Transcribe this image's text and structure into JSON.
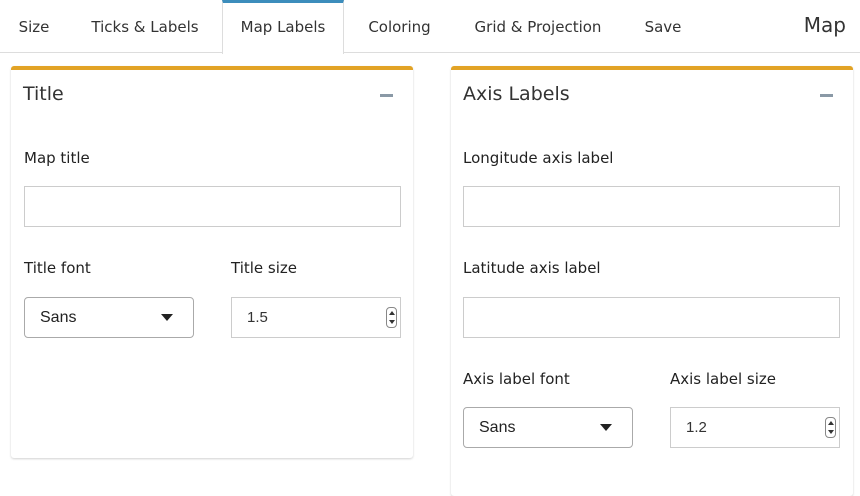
{
  "tabs": [
    {
      "label": "Size",
      "active": false
    },
    {
      "label": "Ticks & Labels",
      "active": false
    },
    {
      "label": "Map Labels",
      "active": true
    },
    {
      "label": "Coloring",
      "active": false
    },
    {
      "label": "Grid & Projection",
      "active": false
    },
    {
      "label": "Save",
      "active": false
    }
  ],
  "header": {
    "title": "Map"
  },
  "colors": {
    "accent_tab": "#3c8dbc",
    "box_border": "#e2a325"
  },
  "title_box": {
    "title": "Title",
    "collapse_icon": "minus-icon",
    "map_title_label": "Map title",
    "map_title_value": "",
    "title_font_label": "Title font",
    "title_font_value": "Sans",
    "title_size_label": "Title size",
    "title_size_value": "1.5"
  },
  "axis_box": {
    "title": "Axis Labels",
    "collapse_icon": "minus-icon",
    "longitude_label": "Longitude axis label",
    "longitude_value": "",
    "latitude_label": "Latitude axis label",
    "latitude_value": "",
    "font_label": "Axis label font",
    "font_value": "Sans",
    "size_label": "Axis label size",
    "size_value": "1.2"
  }
}
